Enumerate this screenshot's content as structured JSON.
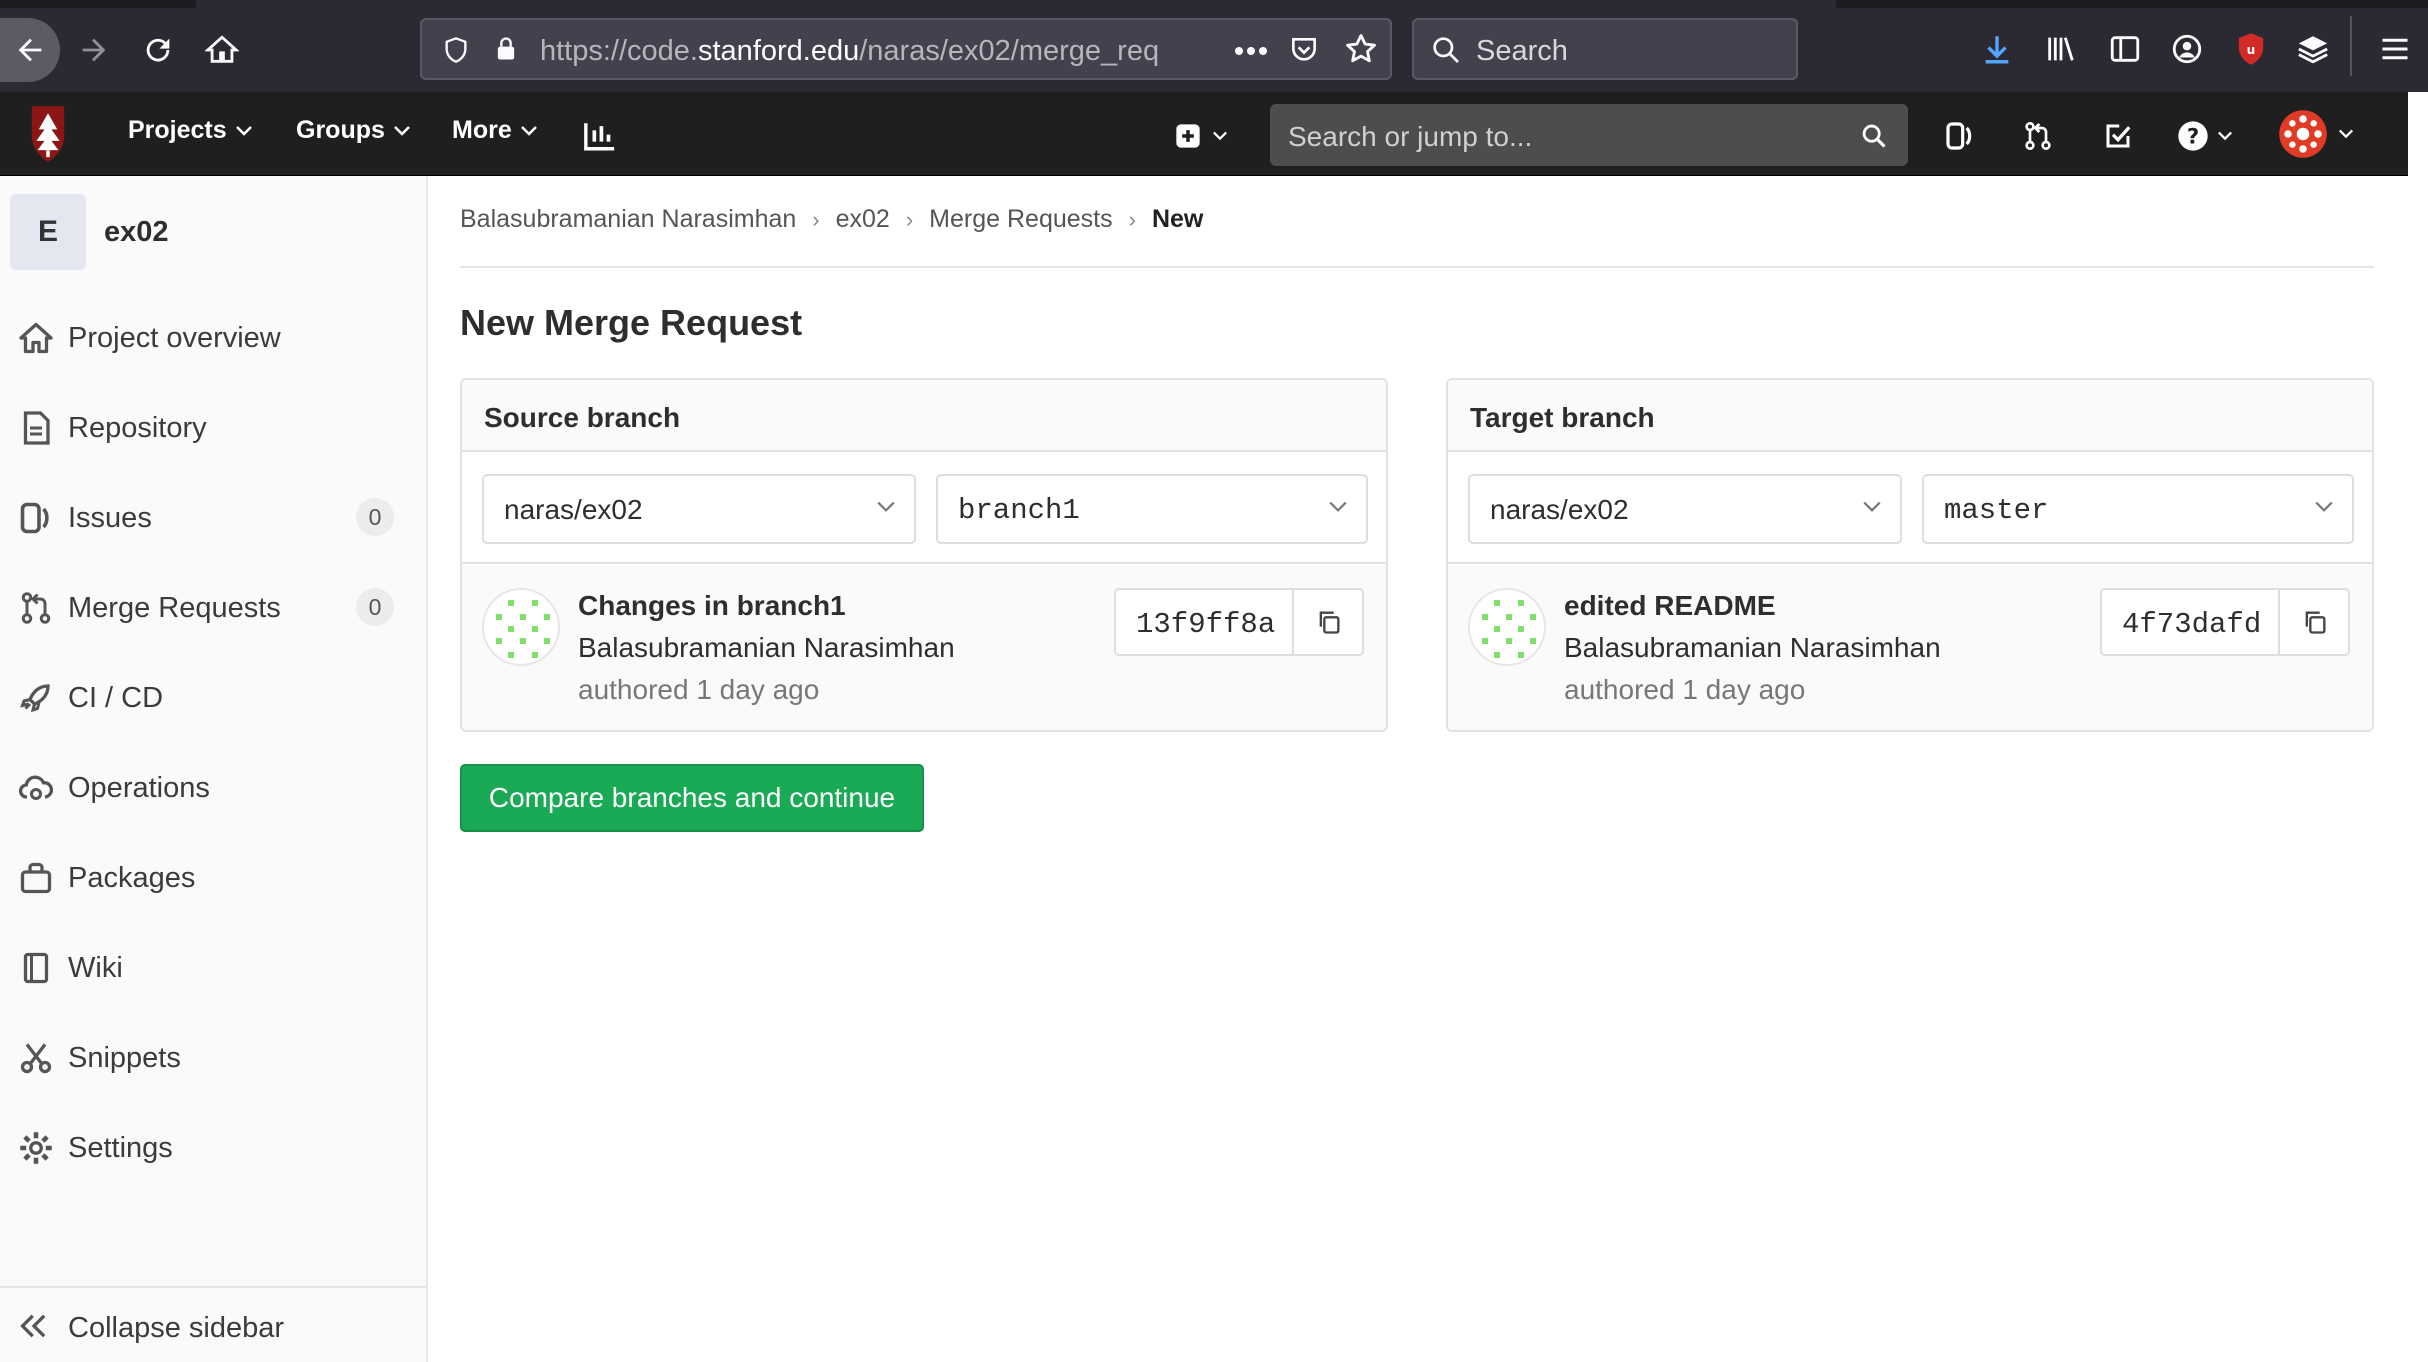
{
  "browser": {
    "url_prefix": "https://code.",
    "url_host": "stanford.edu",
    "url_path": "/naras/ex02/merge_req",
    "search_placeholder": "Search"
  },
  "header": {
    "menu": [
      {
        "label": "Projects"
      },
      {
        "label": "Groups"
      },
      {
        "label": "More"
      }
    ],
    "search_placeholder": "Search or jump to..."
  },
  "sidebar": {
    "project_initial": "E",
    "project_name": "ex02",
    "items": [
      {
        "label": "Project overview"
      },
      {
        "label": "Repository"
      },
      {
        "label": "Issues",
        "count": "0"
      },
      {
        "label": "Merge Requests",
        "count": "0"
      },
      {
        "label": "CI / CD"
      },
      {
        "label": "Operations"
      },
      {
        "label": "Packages"
      },
      {
        "label": "Wiki"
      },
      {
        "label": "Snippets"
      },
      {
        "label": "Settings"
      }
    ],
    "collapse_label": "Collapse sidebar"
  },
  "breadcrumb": [
    "Balasubramanian Narasimhan",
    "ex02",
    "Merge Requests",
    "New"
  ],
  "page": {
    "title": "New Merge Request",
    "source": {
      "heading": "Source branch",
      "project": "naras/ex02",
      "branch": "branch1",
      "commit_title": "Changes in branch1",
      "commit_author": "Balasubramanian Narasimhan",
      "commit_time": "authored 1 day ago",
      "sha": "13f9ff8a"
    },
    "target": {
      "heading": "Target branch",
      "project": "naras/ex02",
      "branch": "master",
      "commit_title": "edited README",
      "commit_author": "Balasubramanian Narasimhan",
      "commit_time": "authored 1 day ago",
      "sha": "4f73dafd"
    },
    "compare_button": "Compare branches and continue"
  },
  "colors": {
    "accent_green": "#1aaa55",
    "header_bg": "#1f1f1f",
    "stanford_red": "#8c1515"
  }
}
